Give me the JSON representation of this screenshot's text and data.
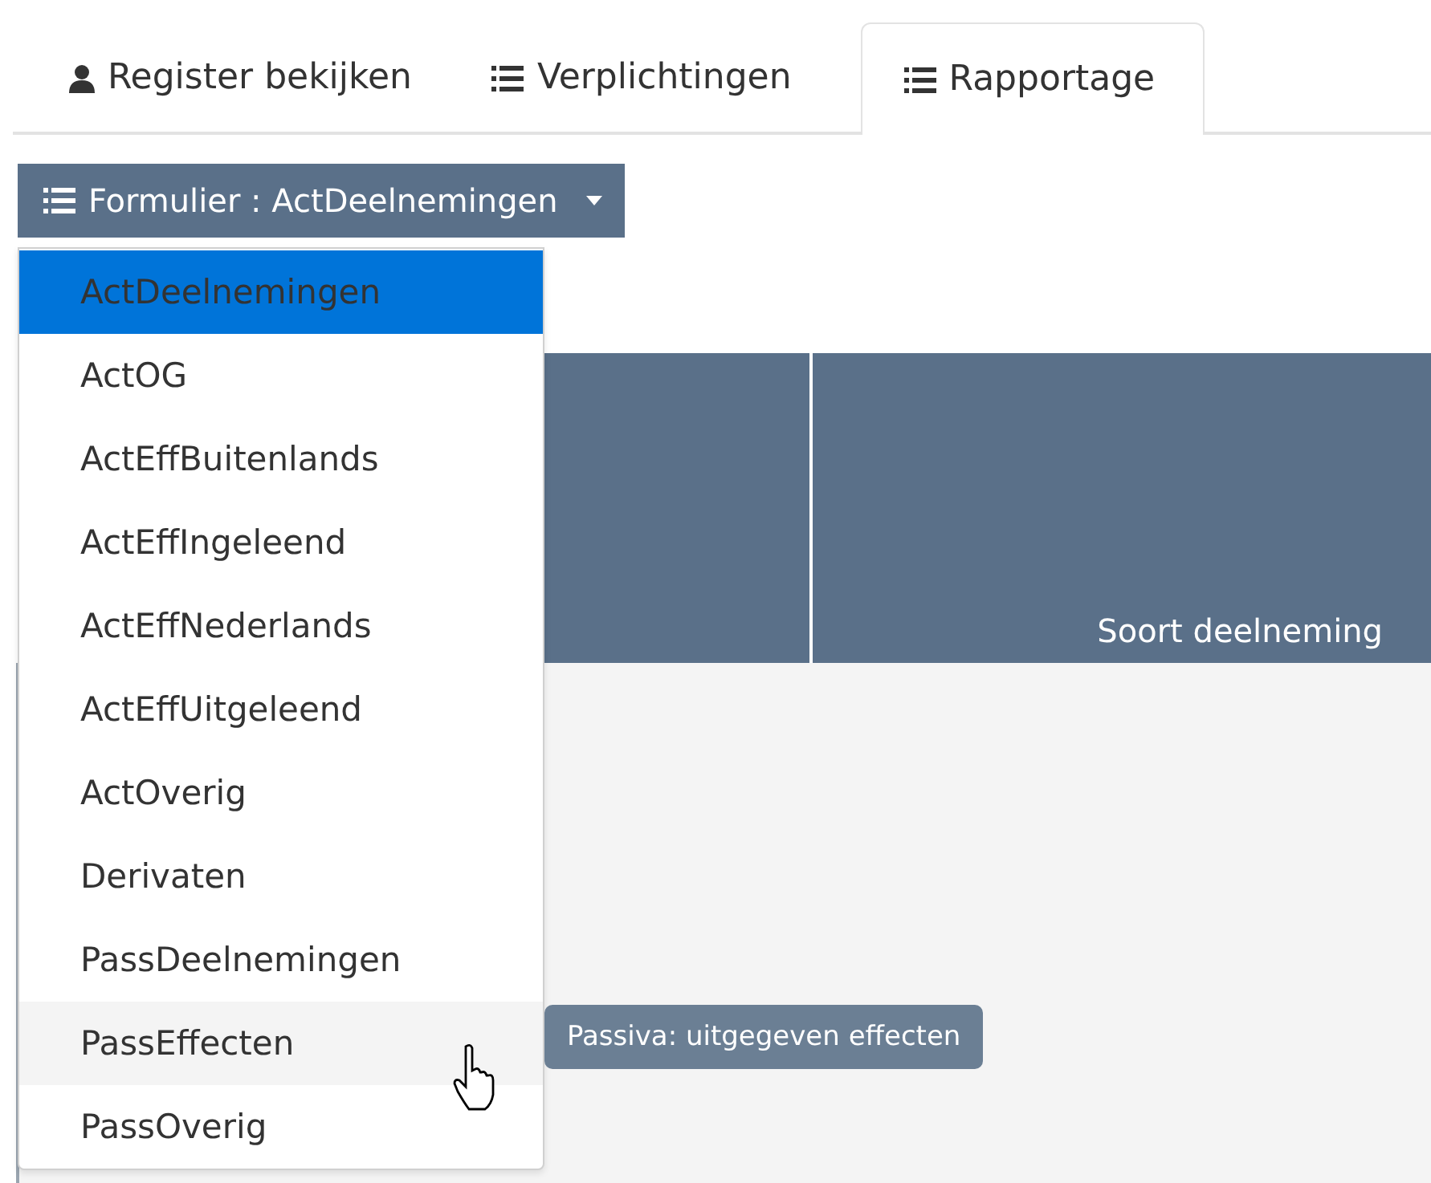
{
  "tabs": [
    {
      "label": "Register bekijken",
      "kind": "user",
      "selected": false
    },
    {
      "label": "Verplichtingen",
      "kind": "list",
      "selected": false
    },
    {
      "label": "Rapportage",
      "kind": "list",
      "selected": true
    }
  ],
  "form_button": {
    "label": "Formulier : ActDeelnemingen"
  },
  "menu": {
    "items": [
      {
        "label": "ActDeelnemingen",
        "selected": true,
        "hovered": false
      },
      {
        "label": "ActOG",
        "selected": false,
        "hovered": false
      },
      {
        "label": "ActEffBuitenlands",
        "selected": false,
        "hovered": false
      },
      {
        "label": "ActEffIngeleend",
        "selected": false,
        "hovered": false
      },
      {
        "label": "ActEffNederlands",
        "selected": false,
        "hovered": false
      },
      {
        "label": "ActEffUitgeleend",
        "selected": false,
        "hovered": false
      },
      {
        "label": "ActOverig",
        "selected": false,
        "hovered": false
      },
      {
        "label": "Derivaten",
        "selected": false,
        "hovered": false
      },
      {
        "label": "PassDeelnemingen",
        "selected": false,
        "hovered": false
      },
      {
        "label": "PassEffecten",
        "selected": false,
        "hovered": true
      },
      {
        "label": "PassOverig",
        "selected": false,
        "hovered": false
      }
    ]
  },
  "tooltip": {
    "text": "Passiva: uitgegeven effecten"
  },
  "table": {
    "columns": [
      "Soort deelneming"
    ]
  }
}
